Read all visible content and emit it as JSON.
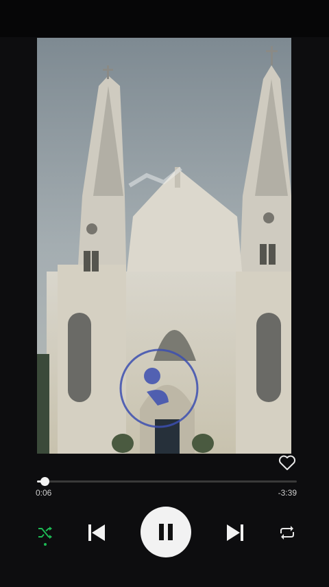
{
  "player": {
    "elapsed": "0:06",
    "remaining": "-3:39",
    "progress": 0.03,
    "liked": false,
    "shuffle_active": true,
    "repeat_active": false
  },
  "colors": {
    "accent": "#1db954",
    "background": "#0d0d0f",
    "control": "#f2f2f2"
  },
  "icons": {
    "like": "heart-outline-icon",
    "shuffle": "shuffle-icon",
    "previous": "skip-previous-icon",
    "play_pause": "pause-icon",
    "next": "skip-next-icon",
    "repeat": "repeat-icon"
  }
}
